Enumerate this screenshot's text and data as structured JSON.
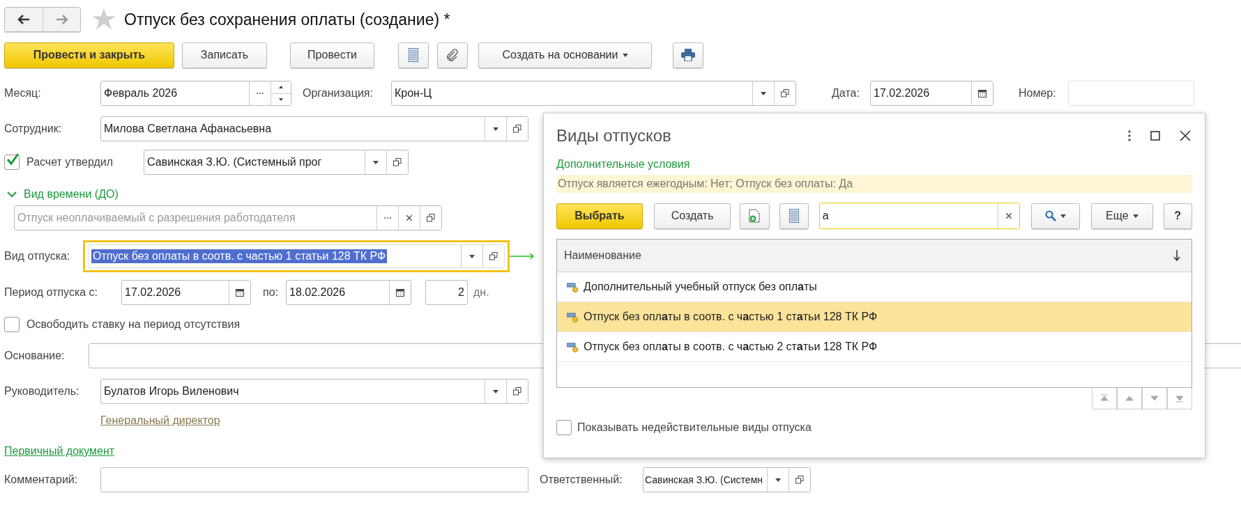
{
  "window": {
    "title": "Отпуск без сохранения оплаты (создание) *"
  },
  "toolbar": [
    {
      "kind": "primary",
      "label": "Провести и закрыть"
    },
    {
      "kind": "text",
      "label": "Записать"
    },
    {
      "kind": "text",
      "label": "Провести"
    },
    {
      "kind": "list"
    },
    {
      "kind": "clip"
    },
    {
      "kind": "dropdown",
      "label": "Создать на основании"
    },
    {
      "kind": "print"
    }
  ],
  "form": {
    "month": {
      "label": "Месяц:",
      "value": "Февраль 2026"
    },
    "organization": {
      "label": "Организация:",
      "value": "Крон-Ц"
    },
    "date": {
      "label": "Дата:",
      "value": "17.02.2026"
    },
    "number": {
      "label": "Номер:"
    },
    "employee": {
      "label": "Сотрудник:",
      "value": "Милова Светлана Афанасьевна"
    },
    "approved": {
      "label": "Расчет утвердил",
      "checked": true,
      "value": "Савинская З.Ю. (Системный прог"
    },
    "time_kind": {
      "label": "Вид времени (ДО)",
      "expanded": true,
      "placeholder": "Отпуск неоплачиваемый с разрешения работодателя"
    },
    "leave_kind": {
      "label": "Вид отпуска:",
      "value": "Отпуск без оплаты в соотв. с частью 1 статьи 128 ТК РФ",
      "text_selected": true
    },
    "period": {
      "label": "Период отпуска с:",
      "from": "17.02.2026",
      "to_label": "по:",
      "to": "18.02.2026",
      "days": "2",
      "days_unit": "дн."
    },
    "release": {
      "label": "Освободить ставку на период отсутствия",
      "checked": false
    },
    "basis": {
      "label": "Основание:"
    },
    "manager": {
      "label": "Руководитель:",
      "value": "Булатов Игорь Виленович",
      "position": "Генеральный директор"
    },
    "primary_doc": "Первичный документ",
    "comment": {
      "label": "Комментарий:"
    },
    "responsible": {
      "label": "Ответственный:",
      "value": "Савинская З.Ю. (Системн"
    }
  },
  "popup": {
    "title": "Виды отпусков",
    "conditions_link": "Дополнительные условия",
    "conditions": "Отпуск является ежегодным: Нет; Отпуск без оплаты: Да",
    "choose": "Выбрать",
    "create": "Создать",
    "search": {
      "value": "а"
    },
    "more": "Еще",
    "help": "?",
    "table": {
      "columns": [
        "Наименование"
      ],
      "rows": [
        {
          "name": "Дополнительный учебный отпуск без опл**а**ты",
          "selected": false
        },
        {
          "name": "Отпуск без опл**а**ты в соотв. с ч**а**стью 1 ст**а**тьи 128 ТК РФ",
          "selected": true
        },
        {
          "name": "Отпуск без опл**а**ты в соотв. с ч**а**стью 2 ст**а**тьи 128 ТК РФ",
          "selected": false
        }
      ]
    },
    "show_invalid": {
      "label": "Показывать недействительные виды отпуска",
      "checked": false
    }
  }
}
